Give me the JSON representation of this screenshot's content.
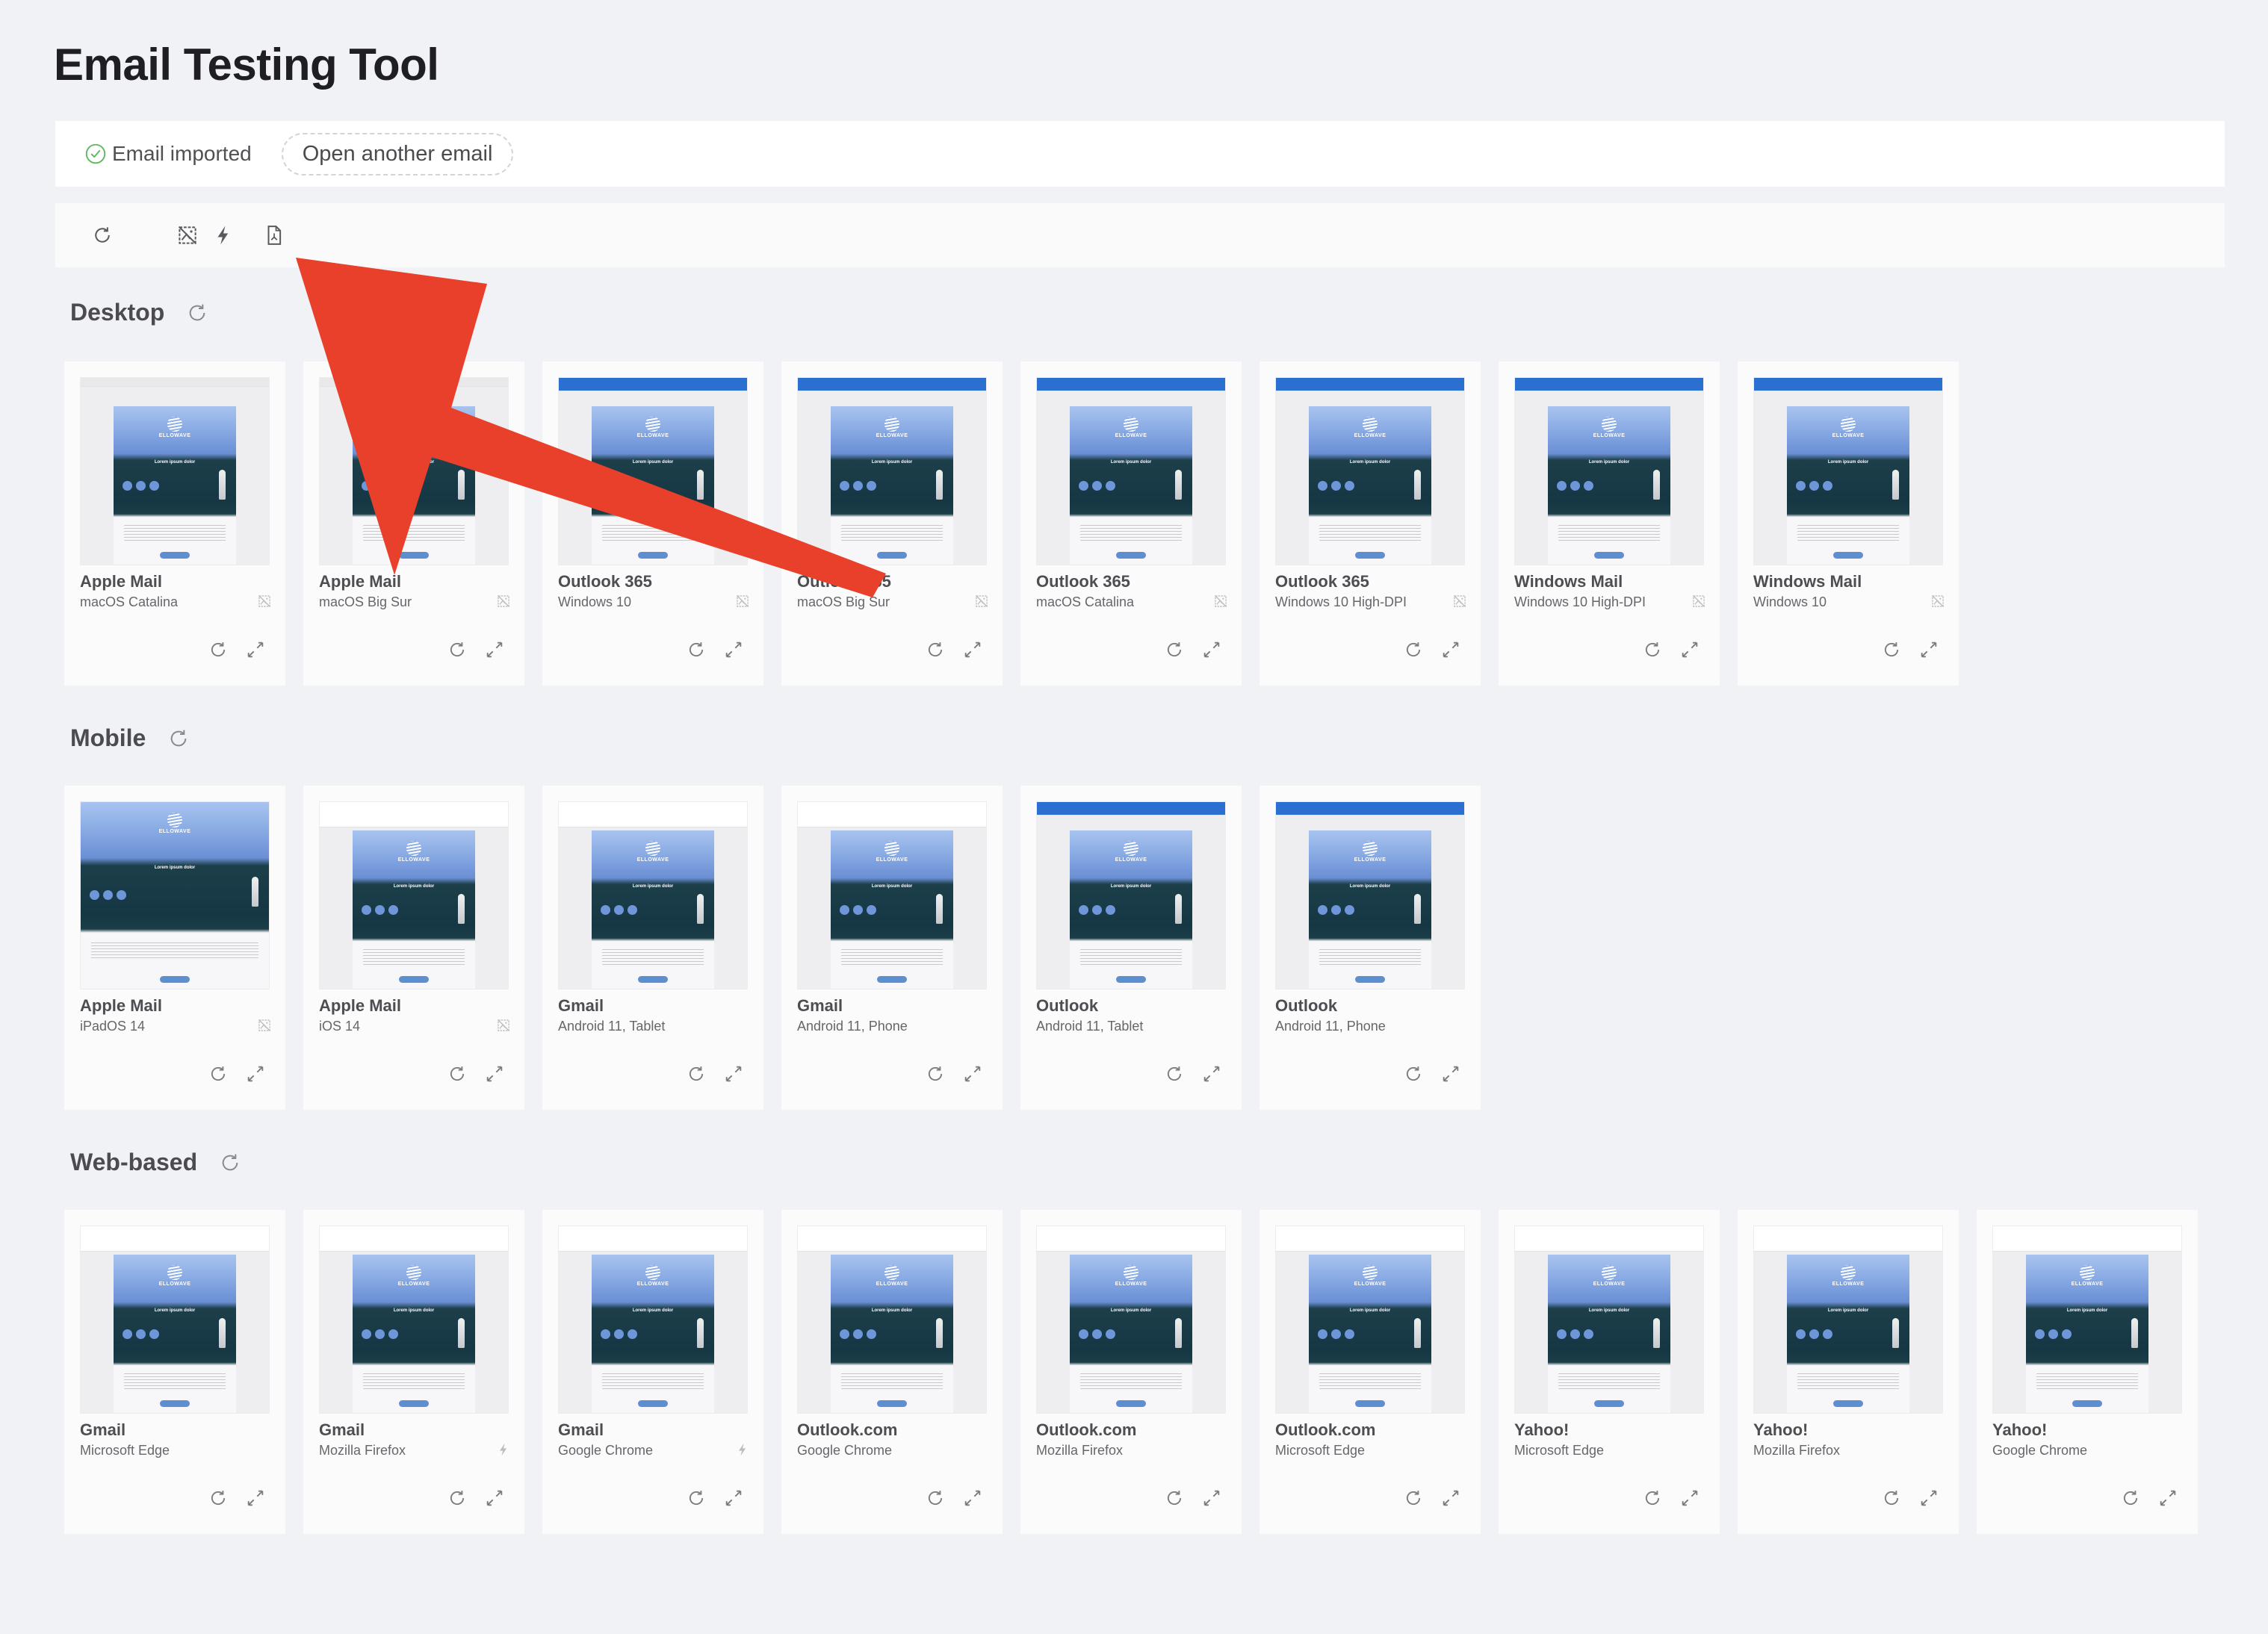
{
  "app": {
    "title": "Email Testing Tool"
  },
  "status": {
    "message": "Email imported",
    "open_another_label": "Open another email",
    "ok_color": "#5cb85c"
  },
  "toolbar": {
    "icons": [
      "refresh-icon",
      "dark-mode-icon",
      "images-off-icon",
      "bolt-icon",
      "pdf-icon"
    ]
  },
  "annotation": {
    "color": "#e8402a",
    "points_to": "pdf-icon"
  },
  "sections": [
    {
      "title": "Desktop",
      "cards": [
        {
          "name": "Apple Mail",
          "platform": "macOS Catalina",
          "flags": [
            "dark-mode",
            "images-off"
          ],
          "chrome": "mac"
        },
        {
          "name": "Apple Mail",
          "platform": "macOS Big Sur",
          "flags": [
            "dark-mode",
            "images-off"
          ],
          "chrome": "mac"
        },
        {
          "name": "Outlook 365",
          "platform": "Windows 10",
          "flags": [
            "dark-mode",
            "images-off"
          ],
          "chrome": "blue"
        },
        {
          "name": "Outlook 365",
          "platform": "macOS Big Sur",
          "flags": [
            "dark-mode",
            "images-off"
          ],
          "chrome": "blue"
        },
        {
          "name": "Outlook 365",
          "platform": "macOS Catalina",
          "flags": [
            "dark-mode",
            "images-off"
          ],
          "chrome": "blue"
        },
        {
          "name": "Outlook 365",
          "platform": "Windows 10 High-DPI",
          "flags": [
            "dark-mode",
            "images-off"
          ],
          "chrome": "blue"
        },
        {
          "name": "Windows Mail",
          "platform": "Windows 10 High-DPI",
          "flags": [
            "dark-mode",
            "images-off"
          ],
          "chrome": "blue"
        },
        {
          "name": "Windows Mail",
          "platform": "Windows 10",
          "flags": [
            "dark-mode",
            "images-off"
          ],
          "chrome": "blue"
        }
      ]
    },
    {
      "title": "Mobile",
      "cards": [
        {
          "name": "Apple Mail",
          "platform": "iPadOS 14",
          "flags": [
            "images-off"
          ],
          "chrome": "none"
        },
        {
          "name": "Apple Mail",
          "platform": "iOS 14",
          "flags": [
            "dark-mode",
            "images-off"
          ],
          "chrome": "white"
        },
        {
          "name": "Gmail",
          "platform": "Android 11, Tablet",
          "flags": [],
          "chrome": "white"
        },
        {
          "name": "Gmail",
          "platform": "Android 11, Phone",
          "flags": [],
          "chrome": "white"
        },
        {
          "name": "Outlook",
          "platform": "Android 11, Tablet",
          "flags": [],
          "chrome": "blue"
        },
        {
          "name": "Outlook",
          "platform": "Android 11, Phone",
          "flags": [],
          "chrome": "blue"
        }
      ]
    },
    {
      "title": "Web-based",
      "cards": [
        {
          "name": "Gmail",
          "platform": "Microsoft Edge",
          "flags": [],
          "chrome": "white"
        },
        {
          "name": "Gmail",
          "platform": "Mozilla Firefox",
          "flags": [
            "bolt"
          ],
          "chrome": "white"
        },
        {
          "name": "Gmail",
          "platform": "Google Chrome",
          "flags": [
            "bolt"
          ],
          "chrome": "white"
        },
        {
          "name": "Outlook.com",
          "platform": "Google Chrome",
          "flags": [
            "dark-mode"
          ],
          "chrome": "white"
        },
        {
          "name": "Outlook.com",
          "platform": "Mozilla Firefox",
          "flags": [
            "dark-mode"
          ],
          "chrome": "white"
        },
        {
          "name": "Outlook.com",
          "platform": "Microsoft Edge",
          "flags": [
            "dark-mode"
          ],
          "chrome": "white"
        },
        {
          "name": "Yahoo!",
          "platform": "Microsoft Edge",
          "flags": [],
          "chrome": "white"
        },
        {
          "name": "Yahoo!",
          "platform": "Mozilla Firefox",
          "flags": [],
          "chrome": "white"
        },
        {
          "name": "Yahoo!",
          "platform": "Google Chrome",
          "flags": [],
          "chrome": "white"
        }
      ]
    }
  ],
  "preview": {
    "brand": "ELLOWAVE",
    "headline": "Lorem ipsum dolor"
  }
}
